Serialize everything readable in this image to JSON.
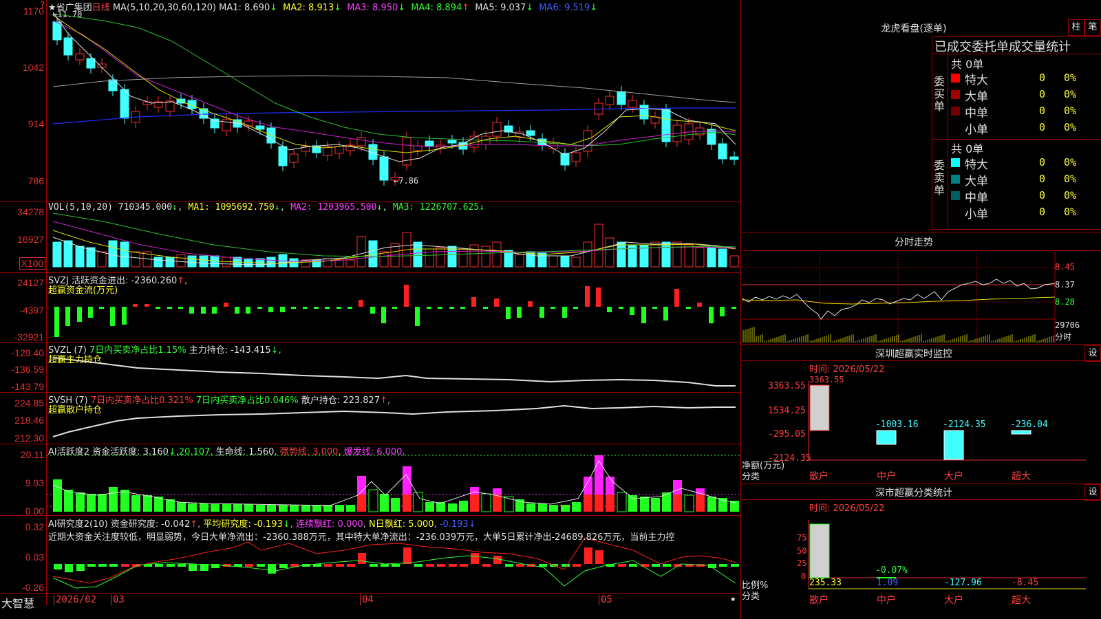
{
  "header": {
    "star": "★",
    "stock_name": "省广集团",
    "period": "日线",
    "ma_params": "MA(5,10,20,30,60,120)",
    "ma": [
      {
        "label": "MA1:",
        "value": "8.690",
        "arrow": "↓",
        "color": "#e0e0e0"
      },
      {
        "label": "MA2:",
        "value": "8.913",
        "arrow": "↓",
        "color": "#ffff30"
      },
      {
        "label": "MA3:",
        "value": "8.950",
        "arrow": "↓",
        "color": "#ff40ff"
      },
      {
        "label": "MA4:",
        "value": "8.894",
        "arrow": "↑",
        "color": "#30ff30"
      },
      {
        "label": "MA5:",
        "value": "9.037",
        "arrow": "↓",
        "color": "#e0e0e0"
      },
      {
        "label": "MA6:",
        "value": "9.519",
        "arrow": "↓",
        "color": "#4060ff"
      }
    ],
    "high_mark": "←11.70",
    "low_mark": "←7.86"
  },
  "price_axis": [
    "1170",
    "1042",
    "914",
    "786"
  ],
  "vol": {
    "title": "VOL(5,10,20)",
    "value": "710345.000",
    "ma1": "MA1: 1095692.750",
    "ma2": "MA2: 1203965.500",
    "ma3": "MA3: 1226707.625",
    "axis": [
      "34278",
      "16927",
      "X100"
    ]
  },
  "svzj": {
    "line1": "SVZJ  活跃资金进出: -2360.260",
    "arrow": "↑",
    "line2": "超赢资金流(万元)",
    "axis": [
      "24127",
      "-4397",
      "-32921"
    ]
  },
  "svzl": {
    "line1a": "SVZL (7) ",
    "line1b": "7日内买卖净占比1.15%",
    "line1c": " 主力持仓: -143.415",
    "arrow": "↓",
    "line2": "超赢主力持仓",
    "axis": [
      "-129.40",
      "-136.59",
      "-143.79"
    ]
  },
  "svsh": {
    "line1a": "SVSH (7) ",
    "line1b": "7日内买卖净占比0.321%",
    "line1c": " 7日内买卖净占比0.046%",
    "line1d": " 散户持仓: 223.827",
    "arrow": "↑",
    "line2": "超赢散户持仓",
    "axis": [
      "224.85",
      "218.46",
      "212.30"
    ]
  },
  "ai1": {
    "t1": "AI活跃度2 资金活跃度: 3.160",
    "a1": "↓",
    "t2": "20.107",
    "t3": " 生命线: 1.560",
    "t4": " 强势线: 3.000",
    "t5": " 爆发线: 6.000,",
    "axis": [
      "20.11",
      "9.93",
      "0.00"
    ]
  },
  "ai2": {
    "t1": "AI研究度2(10) 资金研究度: -0.042",
    "a1": "↑",
    "t2": " 平均研究度: -0.193",
    "a2": "↓",
    "t3": " 连续飘红: 0.000",
    "t4": " N日飘红: 5.000",
    "t5": " -0.193",
    "text": "近期大资金关注度较低，明显弱势，今日大单净流出：-2360.388万元，其中特大单净流出：-236.039万元，大单5日累计净出-24689.826万元，当前主力控",
    "axis": [
      "0.32",
      "0.03",
      "-0.26"
    ]
  },
  "date_axis": {
    "brand": "大智慧",
    "d1": "2026/02",
    "d2": "03",
    "d3": "04",
    "d4": "05"
  },
  "dragon": {
    "title": "龙虎看盘(逐单)",
    "btn1": "柱",
    "btn2": "笔",
    "subtitle": "已成交委托单成交量统计",
    "buy_label": "委买单",
    "sell_label": "委卖单",
    "buy_total": "共 0单",
    "sell_total": "共 0单",
    "buy_rows": [
      {
        "name": "特大",
        "count": "0",
        "pct": "0%",
        "color": "#ff0000"
      },
      {
        "name": "大单",
        "count": "0",
        "pct": "0%",
        "color": "#a00000"
      },
      {
        "name": "中单",
        "count": "0",
        "pct": "0%",
        "color": "#700000"
      },
      {
        "name": "小单",
        "count": "0",
        "pct": "0%",
        "color": "#000000"
      }
    ],
    "sell_rows": [
      {
        "name": "特大",
        "count": "0",
        "pct": "0%",
        "color": "#00ffff"
      },
      {
        "name": "大单",
        "count": "0",
        "pct": "0%",
        "color": "#008080"
      },
      {
        "name": "中单",
        "count": "0",
        "pct": "0%",
        "color": "#006060"
      },
      {
        "name": "小单",
        "count": "0",
        "pct": "0%",
        "color": "#000000"
      }
    ]
  },
  "intraday": {
    "title": "分时走势",
    "axis": [
      "8.45",
      "8.37",
      "8.28",
      "29706",
      "分时"
    ]
  },
  "monitor": {
    "title": "深圳超赢实时监控",
    "btn": "设",
    "time": "时间: 2026/05/22",
    "axis": [
      "3363.55",
      "1534.25",
      "-295.05",
      "-2124.35"
    ],
    "ylabel": "净额(万元)",
    "xlabel": "分类",
    "values": [
      "3363.55",
      "-1003.16",
      "-2124.35",
      "-236.04"
    ],
    "cats": [
      "散户",
      "中户",
      "大户",
      "超大"
    ]
  },
  "classify": {
    "title": "深市超赢分类统计",
    "btn": "设",
    "time": "时间: 2026/05/22",
    "axis": [
      "75",
      "50",
      "25",
      "0"
    ],
    "ylabel": "比例%",
    "xlabel": "分类",
    "values": [
      "235.33",
      "1.09",
      "-127.96",
      "-8.45"
    ],
    "mid": "-0.07%",
    "cats": [
      "散户",
      "中户",
      "大户",
      "超大"
    ]
  }
}
